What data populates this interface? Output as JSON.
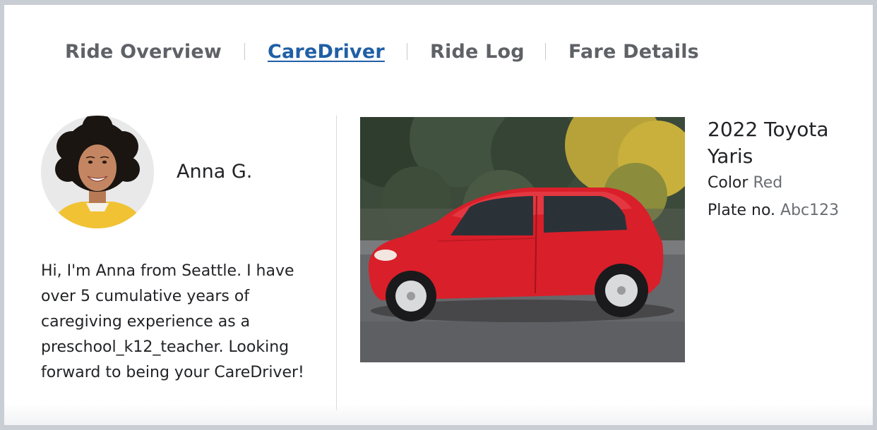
{
  "tabs": [
    {
      "label": "Ride Overview",
      "active": false
    },
    {
      "label": "CareDriver",
      "active": true
    },
    {
      "label": "Ride Log",
      "active": false
    },
    {
      "label": "Fare Details",
      "active": false
    }
  ],
  "driver": {
    "name": "Anna G.",
    "bio": "Hi, I'm Anna from Seattle. I have over 5 cumulative years of caregiving experience as a preschool_k12_teacher. Looking forward to being your CareDriver!"
  },
  "vehicle": {
    "title": "2022 Toyota Yaris",
    "color_label": "Color",
    "color_value": "Red",
    "plate_label": "Plate no.",
    "plate_value": "Abc123"
  },
  "colors": {
    "active_tab": "#1f5fa6",
    "tab_text": "#5e6166",
    "car_body": "#d91f2a"
  }
}
